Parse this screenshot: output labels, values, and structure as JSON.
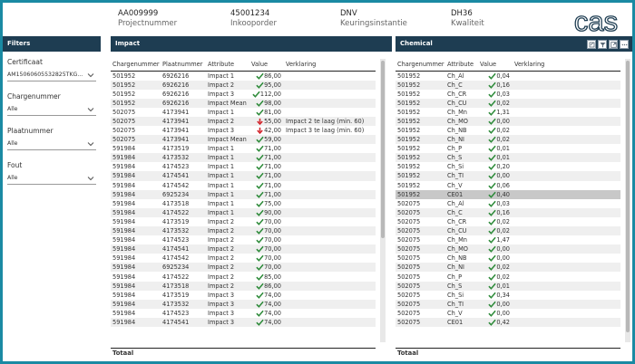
{
  "header": {
    "fields": [
      {
        "value": "AA009999",
        "label": "Projectnummer"
      },
      {
        "value": "45001234",
        "label": "Inkooporder"
      },
      {
        "value": "DNV",
        "label": "Keuringsinstantie"
      },
      {
        "value": "DH36",
        "label": "Kwaliteit"
      }
    ],
    "logo_text": "cas"
  },
  "filters": {
    "title": "Filters",
    "slicers": [
      {
        "label": "Certificaat",
        "value": "AM15060605532825TKG..."
      },
      {
        "label": "Chargenummer",
        "value": "Alle"
      },
      {
        "label": "Plaatnummer",
        "value": "Alle"
      },
      {
        "label": "Fout",
        "value": "Alle"
      }
    ]
  },
  "impact": {
    "title": "Impact",
    "columns": [
      "Chargenummer",
      "Plaatnummer",
      "Attribute",
      "Value",
      "Verklaring"
    ],
    "total_label": "Totaal",
    "rows": [
      {
        "charge": "501952",
        "plaat": "6926216",
        "attr": "Impact 1",
        "status": "ok",
        "value": "86,00",
        "verklaring": ""
      },
      {
        "charge": "501952",
        "plaat": "6926216",
        "attr": "Impact 2",
        "status": "ok",
        "value": "95,00",
        "verklaring": ""
      },
      {
        "charge": "501952",
        "plaat": "6926216",
        "attr": "Impact 3",
        "status": "ok",
        "value": "112,00",
        "verklaring": ""
      },
      {
        "charge": "501952",
        "plaat": "6926216",
        "attr": "Impact Mean",
        "status": "ok",
        "value": "98,00",
        "verklaring": ""
      },
      {
        "charge": "502075",
        "plaat": "4173941",
        "attr": "Impact 1",
        "status": "ok",
        "value": "81,00",
        "verklaring": ""
      },
      {
        "charge": "502075",
        "plaat": "4173941",
        "attr": "Impact 2",
        "status": "fail",
        "value": "55,00",
        "verklaring": "Impact 2 te laag (min. 60)"
      },
      {
        "charge": "502075",
        "plaat": "4173941",
        "attr": "Impact 3",
        "status": "fail",
        "value": "42,00",
        "verklaring": "Impact 3 te laag (min. 60)"
      },
      {
        "charge": "502075",
        "plaat": "4173941",
        "attr": "Impact Mean",
        "status": "ok",
        "value": "59,00",
        "verklaring": ""
      },
      {
        "charge": "591984",
        "plaat": "4173519",
        "attr": "Impact 1",
        "status": "ok",
        "value": "71,00",
        "verklaring": ""
      },
      {
        "charge": "591984",
        "plaat": "4173532",
        "attr": "Impact 1",
        "status": "ok",
        "value": "71,00",
        "verklaring": ""
      },
      {
        "charge": "591984",
        "plaat": "4174523",
        "attr": "Impact 1",
        "status": "ok",
        "value": "71,00",
        "verklaring": ""
      },
      {
        "charge": "591984",
        "plaat": "4174541",
        "attr": "Impact 1",
        "status": "ok",
        "value": "71,00",
        "verklaring": ""
      },
      {
        "charge": "591984",
        "plaat": "4174542",
        "attr": "Impact 1",
        "status": "ok",
        "value": "71,00",
        "verklaring": ""
      },
      {
        "charge": "591984",
        "plaat": "6925234",
        "attr": "Impact 1",
        "status": "ok",
        "value": "71,00",
        "verklaring": ""
      },
      {
        "charge": "591984",
        "plaat": "4173518",
        "attr": "Impact 1",
        "status": "ok",
        "value": "75,00",
        "verklaring": ""
      },
      {
        "charge": "591984",
        "plaat": "4174522",
        "attr": "Impact 1",
        "status": "ok",
        "value": "90,00",
        "verklaring": ""
      },
      {
        "charge": "591984",
        "plaat": "4173519",
        "attr": "Impact 2",
        "status": "ok",
        "value": "70,00",
        "verklaring": ""
      },
      {
        "charge": "591984",
        "plaat": "4173532",
        "attr": "Impact 2",
        "status": "ok",
        "value": "70,00",
        "verklaring": ""
      },
      {
        "charge": "591984",
        "plaat": "4174523",
        "attr": "Impact 2",
        "status": "ok",
        "value": "70,00",
        "verklaring": ""
      },
      {
        "charge": "591984",
        "plaat": "4174541",
        "attr": "Impact 2",
        "status": "ok",
        "value": "70,00",
        "verklaring": ""
      },
      {
        "charge": "591984",
        "plaat": "4174542",
        "attr": "Impact 2",
        "status": "ok",
        "value": "70,00",
        "verklaring": ""
      },
      {
        "charge": "591984",
        "plaat": "6925234",
        "attr": "Impact 2",
        "status": "ok",
        "value": "70,00",
        "verklaring": ""
      },
      {
        "charge": "591984",
        "plaat": "4174522",
        "attr": "Impact 2",
        "status": "ok",
        "value": "85,00",
        "verklaring": ""
      },
      {
        "charge": "591984",
        "plaat": "4173518",
        "attr": "Impact 2",
        "status": "ok",
        "value": "86,00",
        "verklaring": ""
      },
      {
        "charge": "591984",
        "plaat": "4173519",
        "attr": "Impact 3",
        "status": "ok",
        "value": "74,00",
        "verklaring": ""
      },
      {
        "charge": "591984",
        "plaat": "4173532",
        "attr": "Impact 3",
        "status": "ok",
        "value": "74,00",
        "verklaring": ""
      },
      {
        "charge": "591984",
        "plaat": "4174523",
        "attr": "Impact 3",
        "status": "ok",
        "value": "74,00",
        "verklaring": ""
      },
      {
        "charge": "591984",
        "plaat": "4174541",
        "attr": "Impact 3",
        "status": "ok",
        "value": "74,00",
        "verklaring": ""
      }
    ]
  },
  "chemical": {
    "title": "Chemical",
    "columns": [
      "Chargenummer",
      "Attribute",
      "Value",
      "Verklaring"
    ],
    "total_label": "Totaal",
    "rows": [
      {
        "charge": "501952",
        "attr": "Ch_Al",
        "status": "ok",
        "value": "0,04"
      },
      {
        "charge": "501952",
        "attr": "Ch_C",
        "status": "ok",
        "value": "0,16"
      },
      {
        "charge": "501952",
        "attr": "Ch_CR",
        "status": "ok",
        "value": "0,03"
      },
      {
        "charge": "501952",
        "attr": "Ch_CU",
        "status": "ok",
        "value": "0,02"
      },
      {
        "charge": "501952",
        "attr": "Ch_Mn",
        "status": "ok",
        "value": "1,31"
      },
      {
        "charge": "501952",
        "attr": "Ch_MO",
        "status": "ok",
        "value": "0,00"
      },
      {
        "charge": "501952",
        "attr": "Ch_NB",
        "status": "ok",
        "value": "0,02"
      },
      {
        "charge": "501952",
        "attr": "Ch_NI",
        "status": "ok",
        "value": "0,02"
      },
      {
        "charge": "501952",
        "attr": "Ch_P",
        "status": "ok",
        "value": "0,01"
      },
      {
        "charge": "501952",
        "attr": "Ch_S",
        "status": "ok",
        "value": "0,01"
      },
      {
        "charge": "501952",
        "attr": "Ch_Si",
        "status": "ok",
        "value": "0,20"
      },
      {
        "charge": "501952",
        "attr": "Ch_TI",
        "status": "ok",
        "value": "0,00"
      },
      {
        "charge": "501952",
        "attr": "Ch_V",
        "status": "ok",
        "value": "0,06"
      },
      {
        "charge": "501952",
        "attr": "CE01",
        "status": "ok",
        "value": "0,40",
        "selected": true
      },
      {
        "charge": "502075",
        "attr": "Ch_Al",
        "status": "ok",
        "value": "0,03"
      },
      {
        "charge": "502075",
        "attr": "Ch_C",
        "status": "ok",
        "value": "0,16"
      },
      {
        "charge": "502075",
        "attr": "Ch_CR",
        "status": "ok",
        "value": "0,02"
      },
      {
        "charge": "502075",
        "attr": "Ch_CU",
        "status": "ok",
        "value": "0,02"
      },
      {
        "charge": "502075",
        "attr": "Ch_Mn",
        "status": "ok",
        "value": "1,47"
      },
      {
        "charge": "502075",
        "attr": "Ch_MO",
        "status": "ok",
        "value": "0,00"
      },
      {
        "charge": "502075",
        "attr": "Ch_NB",
        "status": "ok",
        "value": "0,00"
      },
      {
        "charge": "502075",
        "attr": "Ch_NI",
        "status": "ok",
        "value": "0,02"
      },
      {
        "charge": "502075",
        "attr": "Ch_P",
        "status": "ok",
        "value": "0,02"
      },
      {
        "charge": "502075",
        "attr": "Ch_S",
        "status": "ok",
        "value": "0,01"
      },
      {
        "charge": "502075",
        "attr": "Ch_Si",
        "status": "ok",
        "value": "0,34"
      },
      {
        "charge": "502075",
        "attr": "Ch_TI",
        "status": "ok",
        "value": "0,00"
      },
      {
        "charge": "502075",
        "attr": "Ch_V",
        "status": "ok",
        "value": "0,00"
      },
      {
        "charge": "502075",
        "attr": "CE01",
        "status": "ok",
        "value": "0,42"
      }
    ]
  },
  "colors": {
    "frame": "#1a8aa3",
    "panel_header": "#1e3d52",
    "ok_check": "#2e8b3a",
    "fail_arrow": "#d2232a",
    "logo": "#1e3d52"
  },
  "icons": {
    "ok": "check-icon",
    "fail": "down-arrow-icon",
    "dropdown": "chevron-down-icon",
    "toolbar": [
      "pin-icon",
      "filter-icon",
      "expand-icon",
      "more-options-icon"
    ]
  }
}
